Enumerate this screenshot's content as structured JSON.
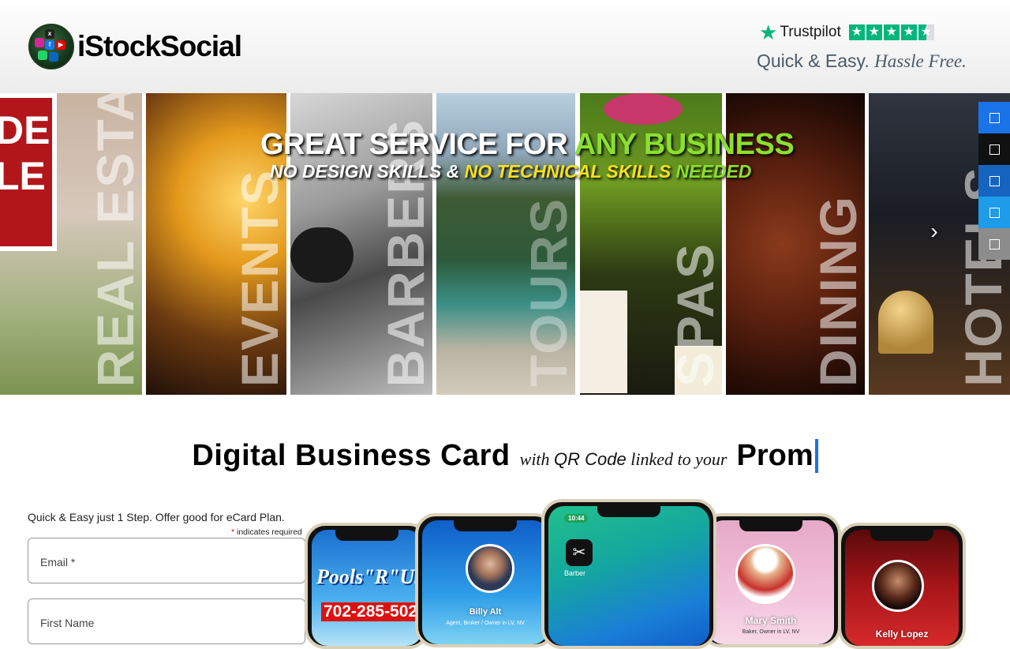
{
  "header": {
    "logo_text": "iStockSocial",
    "trustpilot_label": "Trustpilot",
    "tagline_plain": "Quick & Easy.",
    "tagline_italic": "Hassle Free."
  },
  "banner": {
    "headline_part1": "GREAT SERVICE FOR ",
    "headline_part2": "ANY BUSINESS",
    "sub_part1": "NO DESIGN SKILLS",
    "sub_part2": " & ",
    "sub_part3": "NO TECHNICAL SKILLS",
    "sub_part4": " NEEDED",
    "sign_text": "DE\nLE",
    "panels": [
      "REAL ESTATE",
      "EVENTS",
      "BARBERS",
      "TOURS",
      "SPAS",
      "DINING",
      "HOTELS"
    ],
    "next_arrow": "›"
  },
  "share_bar": {
    "colors": [
      "#1a73e8",
      "#111111",
      "#1565c0",
      "#1e9be9",
      "#8c8c8c"
    ],
    "icons": [
      "facebook-icon",
      "x-icon",
      "linkedin-icon",
      "twitter-icon",
      "share-icon"
    ]
  },
  "title": {
    "bold_left": "Digital Business Card",
    "italic_1": "with",
    "italic_qr": "QR Code",
    "italic_2": "linked to your",
    "typed": "Prom"
  },
  "form": {
    "intro": "Quick & Easy just 1 Step. Offer good for eCard Plan.",
    "required_star": "*",
    "required_text": " indicates required",
    "email_placeholder": "Email *",
    "firstname_placeholder": "First Name"
  },
  "phones": {
    "p1_title": "Pools\"R\"Us",
    "p1_phone": "702-285-502",
    "p2_name": "Billy Alt",
    "p2_sub": "Agent, Broker / Owner in LV, NV",
    "p3_time": "10:44",
    "p3_app": "Barber",
    "p4_name": "Mary Smith",
    "p4_sub": "Baker, Owner in LV, NV",
    "p5_name": "Kelly Lopez"
  }
}
